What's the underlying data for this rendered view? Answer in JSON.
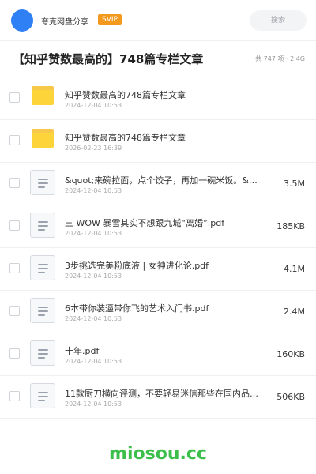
{
  "header": {
    "user_name": "夸克网盘分享",
    "badge": "SVIP",
    "search_placeholder": "搜索",
    "avatar_color": "#2f7ff5"
  },
  "folder": {
    "title": "【知乎赞数最高的】748篇专栏文章",
    "summary": "共 747 项 · 2.4G"
  },
  "files": [
    {
      "icon": "folder-icon",
      "name": "知乎赞数最高的748篇专栏文章",
      "date": "2024-12-04 10:53",
      "size": ""
    },
    {
      "icon": "folder-icon",
      "name": "知乎赞数最高的748篇专栏文章",
      "date": "2026-02-23 16:39",
      "size": ""
    },
    {
      "icon": "document-icon",
      "name": "&quot;来碗拉面，点个饺子，再加一碗米饭。&q…",
      "date": "2024-12-04 10:53",
      "size": "3.5M"
    },
    {
      "icon": "document-icon",
      "name": "三 WOW 暴雪其实不想跟九城“离婚”.pdf",
      "date": "2024-12-04 10:53",
      "size": "185KB"
    },
    {
      "icon": "document-icon",
      "name": "3步挑选完美粉底液 | 女神进化论.pdf",
      "date": "2024-12-04 10:53",
      "size": "4.1M"
    },
    {
      "icon": "document-icon",
      "name": "6本带你装逼带你飞的艺术入门书.pdf",
      "date": "2024-12-04 10:53",
      "size": "2.4M"
    },
    {
      "icon": "document-icon",
      "name": "十年.pdf",
      "date": "2024-12-04 10:53",
      "size": "160KB"
    },
    {
      "icon": "document-icon",
      "name": "11款厨刀横向评测，不要轻易迷信那些在国内品牌名气…",
      "date": "2024-12-04 10:53",
      "size": "506KB"
    }
  ],
  "footer": {
    "brand": "miosou.cc",
    "brand_color": "#3cbf4a"
  }
}
